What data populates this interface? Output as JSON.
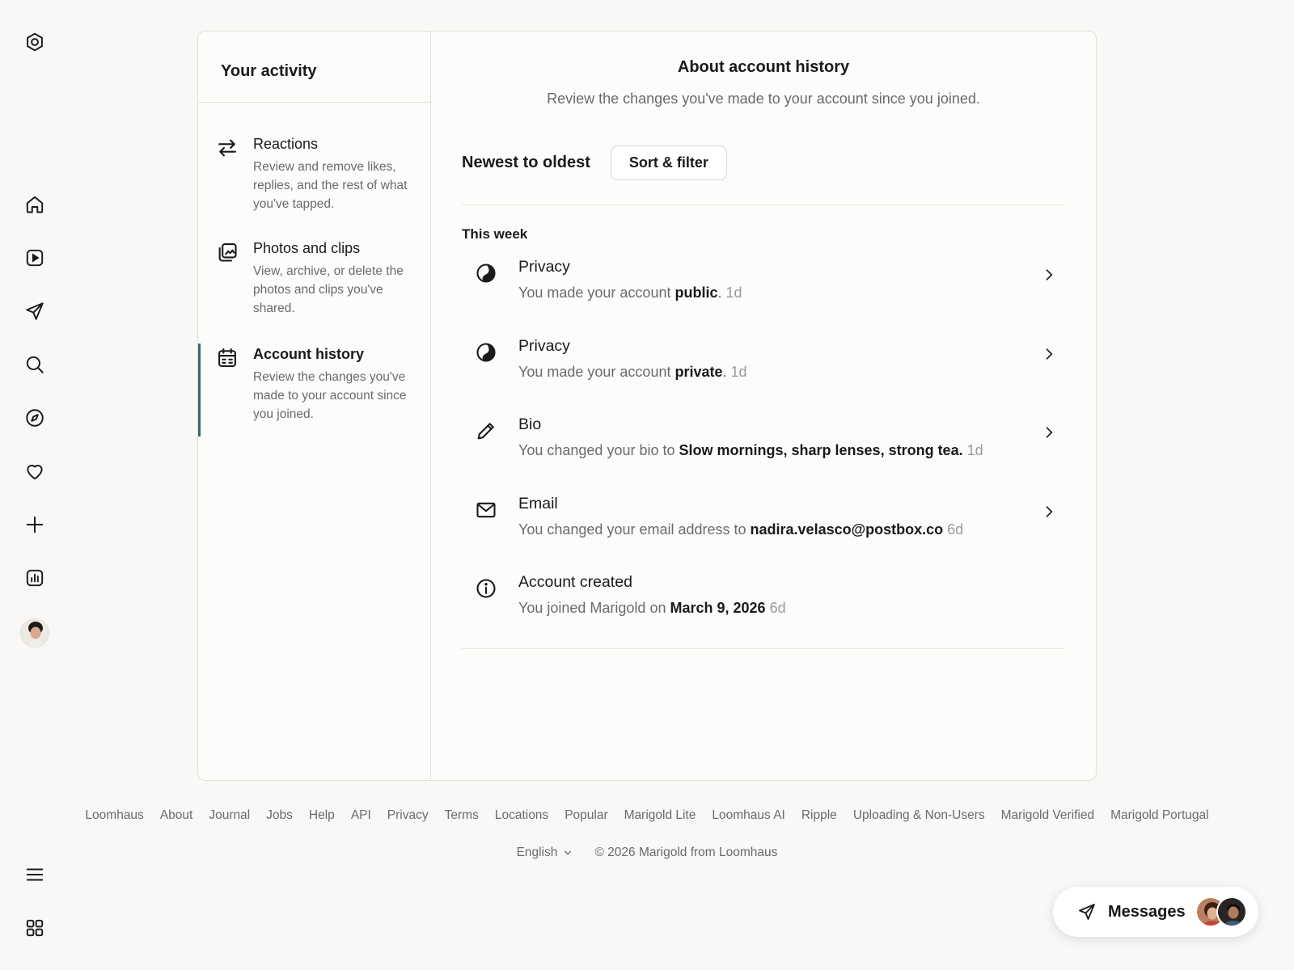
{
  "app": {
    "logo_icon": "hexagon-logo-icon"
  },
  "rail": {
    "items": [
      {
        "name": "home",
        "icon": "home-icon"
      },
      {
        "name": "reels",
        "icon": "play-icon"
      },
      {
        "name": "direct",
        "icon": "send-icon"
      },
      {
        "name": "search",
        "icon": "search-icon"
      },
      {
        "name": "explore",
        "icon": "compass-icon"
      },
      {
        "name": "notifications",
        "icon": "heart-icon"
      },
      {
        "name": "create",
        "icon": "plus-icon"
      },
      {
        "name": "dashboard",
        "icon": "chart-icon"
      },
      {
        "name": "profile",
        "icon": "avatar"
      }
    ],
    "more_icon": "menu-icon",
    "apps_icon": "grid-icon"
  },
  "sidebar": {
    "title": "Your activity",
    "items": [
      {
        "title": "Reactions",
        "desc": "Review and remove likes, replies, and the rest of what you've tapped.",
        "icon": "arrows-swap-icon"
      },
      {
        "title": "Photos and clips",
        "desc": "View, archive, or delete the photos and clips you've shared.",
        "icon": "photos-icon"
      },
      {
        "title": "Account history",
        "desc": "Review the changes you've made to your account since you joined.",
        "icon": "calendar-icon",
        "active": true
      }
    ]
  },
  "main": {
    "title": "About account history",
    "subtitle": "Review the changes you've made to your account since you joined.",
    "sort_label": "Newest to oldest",
    "sort_button": "Sort & filter",
    "section": "This week",
    "entries": [
      {
        "title": "Privacy",
        "pre": "You made your account ",
        "bold": "public",
        "post": ".",
        "age": "1d",
        "icon": "privacy-icon",
        "chevron": true
      },
      {
        "title": "Privacy",
        "pre": "You made your account ",
        "bold": "private",
        "post": ".",
        "age": "1d",
        "icon": "privacy-icon",
        "chevron": true
      },
      {
        "title": "Bio",
        "pre": "You changed your bio to ",
        "bold": "Slow mornings, sharp lenses, strong tea.",
        "post": "",
        "age": "1d",
        "icon": "pencil-icon",
        "chevron": true
      },
      {
        "title": "Email",
        "pre": "You changed your email address to ",
        "bold": "nadira.velasco@postbox.co",
        "post": "",
        "age": "6d",
        "icon": "mail-icon",
        "chevron": true
      },
      {
        "title": "Account created",
        "pre": "You joined Marigold on ",
        "bold": "March 9, 2026",
        "post": "",
        "age": "6d",
        "icon": "info-icon",
        "chevron": false
      }
    ]
  },
  "footer": {
    "links": [
      "Loomhaus",
      "About",
      "Journal",
      "Jobs",
      "Help",
      "API",
      "Privacy",
      "Terms",
      "Locations",
      "Popular",
      "Marigold Lite",
      "Loomhaus AI",
      "Ripple",
      "Uploading & Non-Users",
      "Marigold Verified",
      "Marigold Portugal"
    ],
    "language": "English",
    "copyright": "© 2026 Marigold from Loomhaus"
  },
  "messages": {
    "label": "Messages"
  },
  "colors": {
    "accent": "#2f6f6a",
    "background": "#f9f8f6",
    "muted_text": "#6a6a6a"
  }
}
